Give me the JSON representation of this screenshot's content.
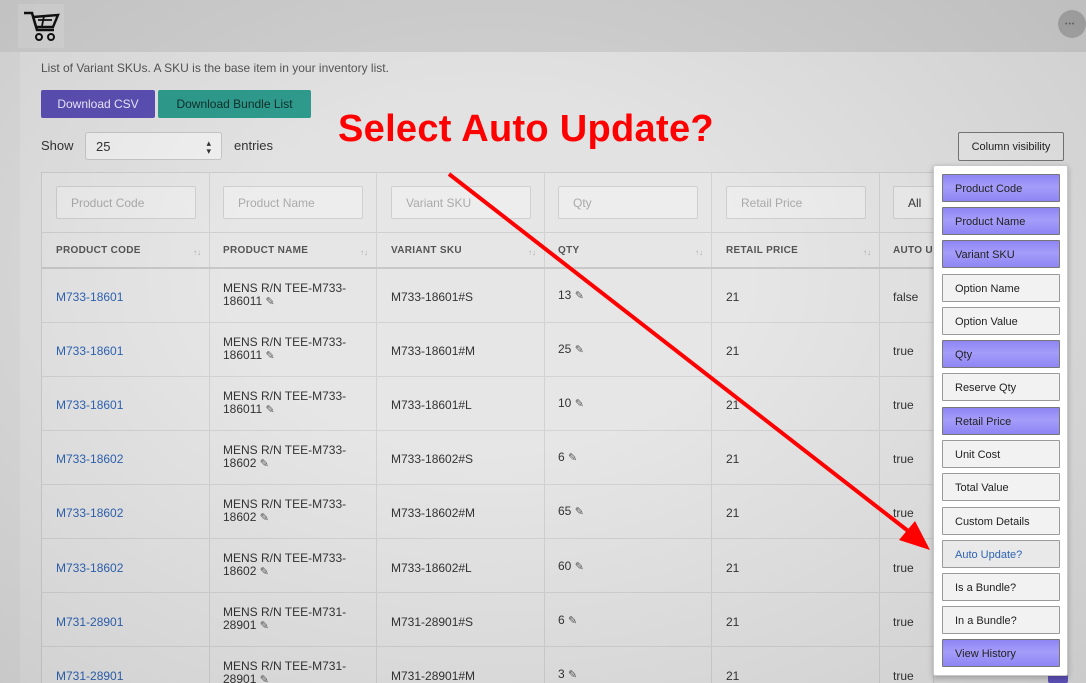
{
  "header": {
    "logo_icon": "cart-logo",
    "avatar_text": "•••"
  },
  "description": "List of Variant SKUs. A SKU is the base item in your inventory list.",
  "toolbar": {
    "download_csv": "Download CSV",
    "download_bundle": "Download Bundle List"
  },
  "length": {
    "show_label": "Show",
    "value": "25",
    "entries_label": "entries"
  },
  "column_visibility_button": "Column visibility",
  "filters": {
    "product_code": "Product Code",
    "product_name": "Product Name",
    "variant_sku": "Variant SKU",
    "qty": "Qty",
    "retail_price": "Retail Price",
    "auto_update": "All"
  },
  "table": {
    "headers": [
      "PRODUCT CODE",
      "PRODUCT NAME",
      "VARIANT SKU",
      "QTY",
      "RETAIL PRICE",
      "AUTO U"
    ],
    "rows": [
      {
        "code": "M733-18601",
        "name1": "MENS R/N TEE-M733-",
        "name2": "186011",
        "sku": "M733-18601#S",
        "qty": "13",
        "price": "21",
        "auto": "false"
      },
      {
        "code": "M733-18601",
        "name1": "MENS R/N TEE-M733-",
        "name2": "186011",
        "sku": "M733-18601#M",
        "qty": "25",
        "price": "21",
        "auto": "true"
      },
      {
        "code": "M733-18601",
        "name1": "MENS R/N TEE-M733-",
        "name2": "186011",
        "sku": "M733-18601#L",
        "qty": "10",
        "price": "21",
        "auto": "true"
      },
      {
        "code": "M733-18602",
        "name1": "MENS R/N TEE-M733-",
        "name2": "18602",
        "sku": "M733-18602#S",
        "qty": "6",
        "price": "21",
        "auto": "true"
      },
      {
        "code": "M733-18602",
        "name1": "MENS R/N TEE-M733-",
        "name2": "18602",
        "sku": "M733-18602#M",
        "qty": "65",
        "price": "21",
        "auto": "true"
      },
      {
        "code": "M733-18602",
        "name1": "MENS R/N TEE-M733-",
        "name2": "18602",
        "sku": "M733-18602#L",
        "qty": "60",
        "price": "21",
        "auto": "true"
      },
      {
        "code": "M731-28901",
        "name1": "MENS R/N TEE-M731-",
        "name2": "28901",
        "sku": "M731-28901#S",
        "qty": "6",
        "price": "21",
        "auto": "true"
      },
      {
        "code": "M731-28901",
        "name1": "MENS R/N TEE-M731-",
        "name2": "28901",
        "sku": "M731-28901#M",
        "qty": "3",
        "price": "21",
        "auto": "true"
      }
    ]
  },
  "column_visibility_menu": [
    {
      "label": "Product Code",
      "active": true
    },
    {
      "label": "Product Name",
      "active": true
    },
    {
      "label": "Variant SKU",
      "active": true
    },
    {
      "label": "Option Name",
      "active": false
    },
    {
      "label": "Option Value",
      "active": false
    },
    {
      "label": "Qty",
      "active": true
    },
    {
      "label": "Reserve Qty",
      "active": false
    },
    {
      "label": "Retail Price",
      "active": true
    },
    {
      "label": "Unit Cost",
      "active": false
    },
    {
      "label": "Total Value",
      "active": false
    },
    {
      "label": "Custom Details",
      "active": false
    },
    {
      "label": "Auto Update?",
      "active": false,
      "highlight": true
    },
    {
      "label": "Is a Bundle?",
      "active": false
    },
    {
      "label": "In a Bundle?",
      "active": false
    },
    {
      "label": "View History",
      "active": true
    }
  ],
  "annotation": "Select Auto Update?",
  "colors": {
    "active_column": "#9189f6",
    "annotation": "#ff0000",
    "link": "#2e63b3"
  }
}
